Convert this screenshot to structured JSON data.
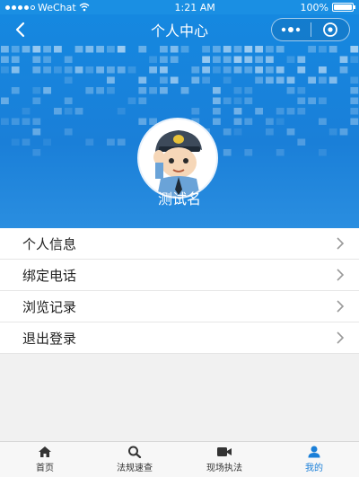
{
  "status_bar": {
    "carrier": "WeChat",
    "time": "1:21 AM",
    "battery": "100%"
  },
  "nav": {
    "title": "个人中心",
    "back_icon": "chevron-left-icon",
    "more_icon": "more-dots-icon",
    "close_icon": "target-circle-icon"
  },
  "profile": {
    "name": "测试名",
    "avatar_icon": "police-officer-avatar"
  },
  "menu": {
    "items": [
      {
        "label": "个人信息"
      },
      {
        "label": "绑定电话"
      },
      {
        "label": "浏览记录"
      },
      {
        "label": "退出登录"
      }
    ]
  },
  "tabs": [
    {
      "label": "首页",
      "icon": "home-icon",
      "active": false
    },
    {
      "label": "法规速查",
      "icon": "search-icon",
      "active": false
    },
    {
      "label": "现场执法",
      "icon": "video-camera-icon",
      "active": false
    },
    {
      "label": "我的",
      "icon": "user-icon",
      "active": true
    }
  ],
  "colors": {
    "primary": "#1a7fd8",
    "background": "#f1f1f1"
  }
}
